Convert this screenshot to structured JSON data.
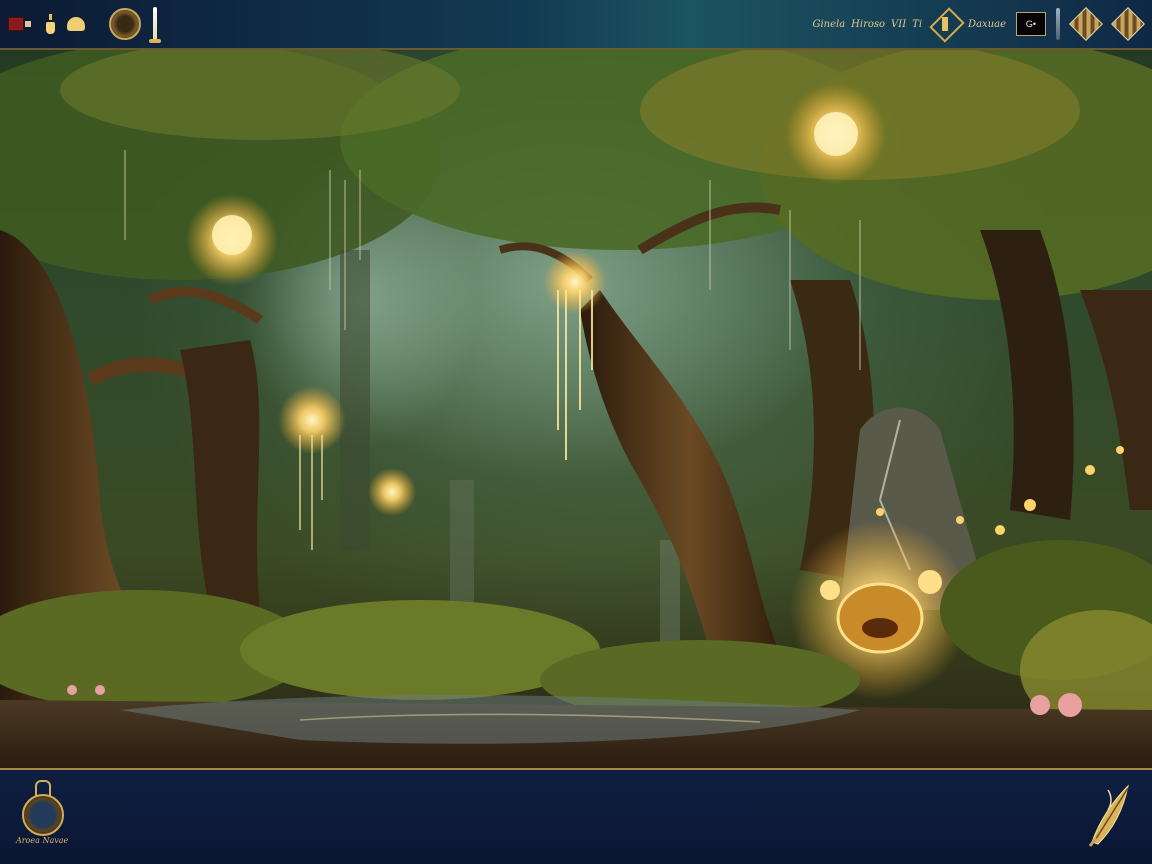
{
  "hud": {
    "left_icons": [
      "flag-icon",
      "potion-icon",
      "helmet-icon",
      "compass-icon",
      "quill-icon"
    ],
    "status_text": [
      "Ginela",
      "Hiroso",
      "VII",
      "Ti"
    ],
    "status_suffix": "Daxuae",
    "mode_button_label": "G•",
    "right_icons": [
      "crest-icon",
      "sword-icon",
      "map-tile-icon"
    ]
  },
  "scene": {
    "name": "Enchanted forest clearing",
    "icons": [
      "glowing-lantern-icon",
      "golden-chest-icon"
    ]
  },
  "bottom": {
    "medallion_label": "Aroea Navae",
    "icons": [
      "medallion-icon",
      "golden-feather-icon"
    ]
  },
  "colors": {
    "hud_gold": "#e2c98f",
    "border_gold": "#a88a4a",
    "panel_navy": "#0f1f40",
    "lantern_glow": "#ffd36a"
  }
}
